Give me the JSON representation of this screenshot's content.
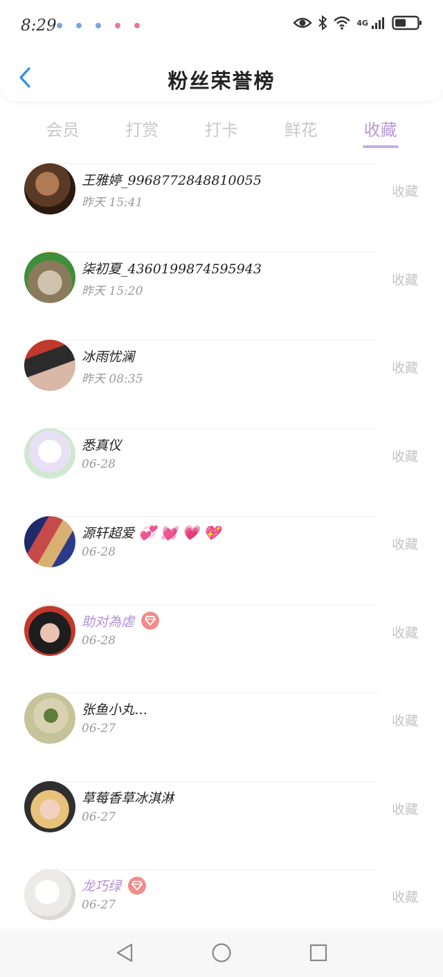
{
  "status_bar": {
    "time": "8:29",
    "network": "4G",
    "notif_colors": [
      "#6fa3e8",
      "#6fa3e8",
      "#6fa3e8",
      "#e86f8f",
      "#e86f8f"
    ],
    "icons": [
      "eye-icon",
      "bluetooth-icon",
      "wifi-icon",
      "signal-icon",
      "battery-icon"
    ]
  },
  "header": {
    "title": "粉丝荣誉榜",
    "back_icon": "chevron-left-icon"
  },
  "tabs": [
    {
      "label": "会员",
      "active": false
    },
    {
      "label": "打赏",
      "active": false
    },
    {
      "label": "打卡",
      "active": false
    },
    {
      "label": "鲜花",
      "active": false
    },
    {
      "label": "收藏",
      "active": true
    }
  ],
  "fans": [
    {
      "name": "王雅婷_9968772848810055",
      "time": "昨天 15:41",
      "action": "收藏",
      "vip": false
    },
    {
      "name": "柒初夏_4360199874595943",
      "time": "昨天 15:20",
      "action": "收藏",
      "vip": false
    },
    {
      "name": "冰雨忧澜",
      "time": "昨天 08:35",
      "action": "收藏",
      "vip": false
    },
    {
      "name": "悉真仪",
      "time": "06-28",
      "action": "收藏",
      "vip": false
    },
    {
      "name": "源轩超爱",
      "emojis": "💞 💓 💗 💖",
      "time": "06-28",
      "action": "收藏",
      "vip": false
    },
    {
      "name": "助对為虐",
      "time": "06-28",
      "action": "收藏",
      "vip": true
    },
    {
      "name": "张鱼小丸…",
      "time": "06-27",
      "action": "收藏",
      "vip": false
    },
    {
      "name": "草莓香草冰淇淋",
      "time": "06-27",
      "action": "收藏",
      "vip": false
    },
    {
      "name": "龙巧绿",
      "time": "06-27",
      "action": "收藏",
      "vip": true
    }
  ],
  "colors": {
    "accent": "#b89ad9",
    "vip_name": "#b08fd8",
    "badge": "#f08c8c"
  },
  "bottom_nav": [
    "back-triangle-icon",
    "home-circle-icon",
    "recents-square-icon"
  ]
}
